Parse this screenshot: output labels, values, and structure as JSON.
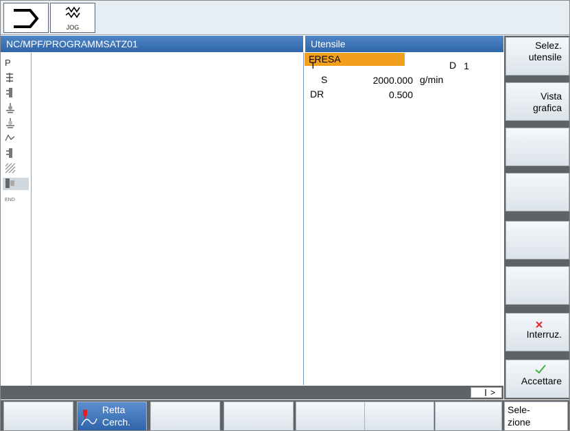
{
  "mode": {
    "machine_icon": "cycle-arrow-icon",
    "jog_label": "JOG"
  },
  "header": {
    "program_path": "NC/MPF/PROGRAMMSATZ01",
    "panel_title": "Utensile"
  },
  "left_icons": [
    {
      "name": "program-p-icon",
      "glyph": "P"
    },
    {
      "name": "drilling-icon",
      "glyph": "⚑"
    },
    {
      "name": "turning-icon",
      "glyph": "▐"
    },
    {
      "name": "contour-icon",
      "glyph": "⚔"
    },
    {
      "name": "milling-icon",
      "glyph": "⚔"
    },
    {
      "name": "path-icon",
      "glyph": "≈"
    },
    {
      "name": "groove-icon",
      "glyph": "▐"
    },
    {
      "name": "pocket-icon",
      "glyph": "▒"
    },
    {
      "name": "straight-circle-icon",
      "glyph": "▦"
    },
    {
      "name": "end-icon",
      "glyph": "END"
    }
  ],
  "fields": {
    "t_label": "T",
    "tool_name": "FRESA",
    "d_label": "D",
    "d_value": "1",
    "s_label": "S",
    "s_value": "2000.000",
    "s_unit": "g/min",
    "dr_label": "DR",
    "dr_value": "0.500"
  },
  "scroll_indicator": ">",
  "vertical_softkeys": [
    {
      "line1": "Selez.",
      "line2": "utensile"
    },
    {
      "line1": "Vista",
      "line2": "grafica"
    },
    {
      "line1": "",
      "line2": ""
    },
    {
      "line1": "",
      "line2": ""
    },
    {
      "line1": "",
      "line2": ""
    },
    {
      "line1": "",
      "line2": ""
    },
    {
      "line1": "Interruz.",
      "line2": "",
      "icon": "red-x-icon"
    },
    {
      "line1": "Accettare",
      "line2": "",
      "icon": "green-check-icon"
    }
  ],
  "horizontal_softkeys": [
    {
      "line1": "",
      "line2": ""
    },
    {
      "line1": "Retta",
      "line2": "Cerch.",
      "active": true
    },
    {
      "line1": "",
      "line2": ""
    },
    {
      "line1": "",
      "line2": ""
    },
    {
      "line1": "",
      "line2": ""
    },
    {
      "line1": "",
      "line2": ""
    },
    {
      "line1": "",
      "line2": ""
    },
    {
      "line1": "Sele-",
      "line2": "zione"
    }
  ],
  "colors": {
    "header_blue": "#2f66a9",
    "tool_orange": "#f29f1d",
    "softkey_gray": "#5f6366",
    "cancel_red": "#e03030",
    "accept_green": "#3cb043"
  }
}
